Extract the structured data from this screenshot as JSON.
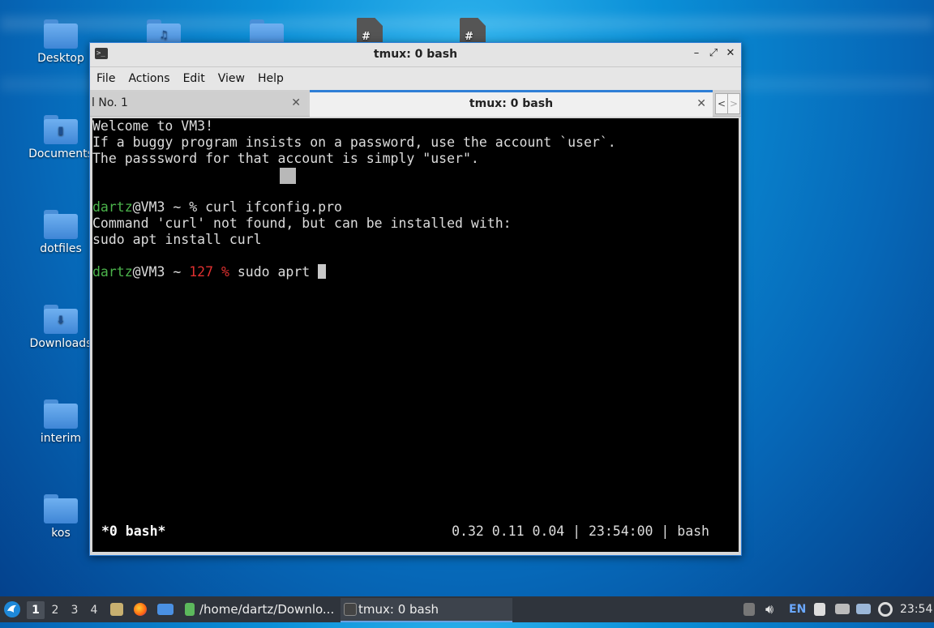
{
  "desktop": {
    "icons": [
      {
        "label": "Desktop",
        "icon": "folder-icon"
      },
      {
        "label": "",
        "icon": "music-folder-icon"
      },
      {
        "label": "",
        "icon": "folder-icon"
      },
      {
        "label": "",
        "icon": "spreadsheet-icon"
      },
      {
        "label": "",
        "icon": "spreadsheet-icon"
      },
      {
        "label": "Documents",
        "icon": "documents-folder-icon"
      },
      {
        "label": "dotfiles",
        "icon": "folder-icon"
      },
      {
        "label": "Downloads",
        "icon": "downloads-folder-icon"
      },
      {
        "label": "interim",
        "icon": "folder-icon"
      },
      {
        "label": "kos",
        "icon": "folder-icon"
      }
    ]
  },
  "window": {
    "title": "tmux: 0 bash",
    "controls": {
      "minimize": "–",
      "maximize": "⤢",
      "close": "✕"
    },
    "menu": [
      "File",
      "Actions",
      "Edit",
      "View",
      "Help"
    ],
    "tabs": [
      {
        "label": "l No. 1",
        "active": false,
        "close": "✕"
      },
      {
        "label": "tmux: 0 bash",
        "active": true,
        "close": "✕"
      }
    ],
    "nav": {
      "prev": "<",
      "next": ">"
    }
  },
  "terminal": {
    "welcome": [
      "Welcome to VM3!",
      "If a buggy program insists on a password, use the account `user`.",
      "The passsword for that account is simply \"user\"."
    ],
    "prompt1": {
      "user": "dartz",
      "host": "@VM3 ~ ",
      "symbol": "% ",
      "command": "curl ifconfig.pro"
    },
    "output": [
      "Command 'curl' not found, but can be installed with:",
      "sudo apt install curl"
    ],
    "prompt2": {
      "user": "dartz",
      "host": "@VM3 ~ ",
      "code": "127 % ",
      "command": "sudo aprt "
    },
    "status_left": "*0 bash*",
    "status_right": "0.32 0.11 0.04 | 23:54:00 | bash"
  },
  "taskbar": {
    "workspaces": [
      "1",
      "2",
      "3",
      "4"
    ],
    "active_workspace": "1",
    "tasks": [
      {
        "label": "/home/dartz/Downlo...",
        "icon": "terminal-icon",
        "active": false
      },
      {
        "label": "tmux: 0 bash",
        "icon": "terminal-icon",
        "active": true
      }
    ],
    "keyboard_layout": "EN",
    "clock": "23:54"
  },
  "colors": {
    "accent": "#2f7fd6",
    "prompt_user": "#4bb34b",
    "exit_code": "#e03030",
    "taskbar": "#2f343c"
  }
}
